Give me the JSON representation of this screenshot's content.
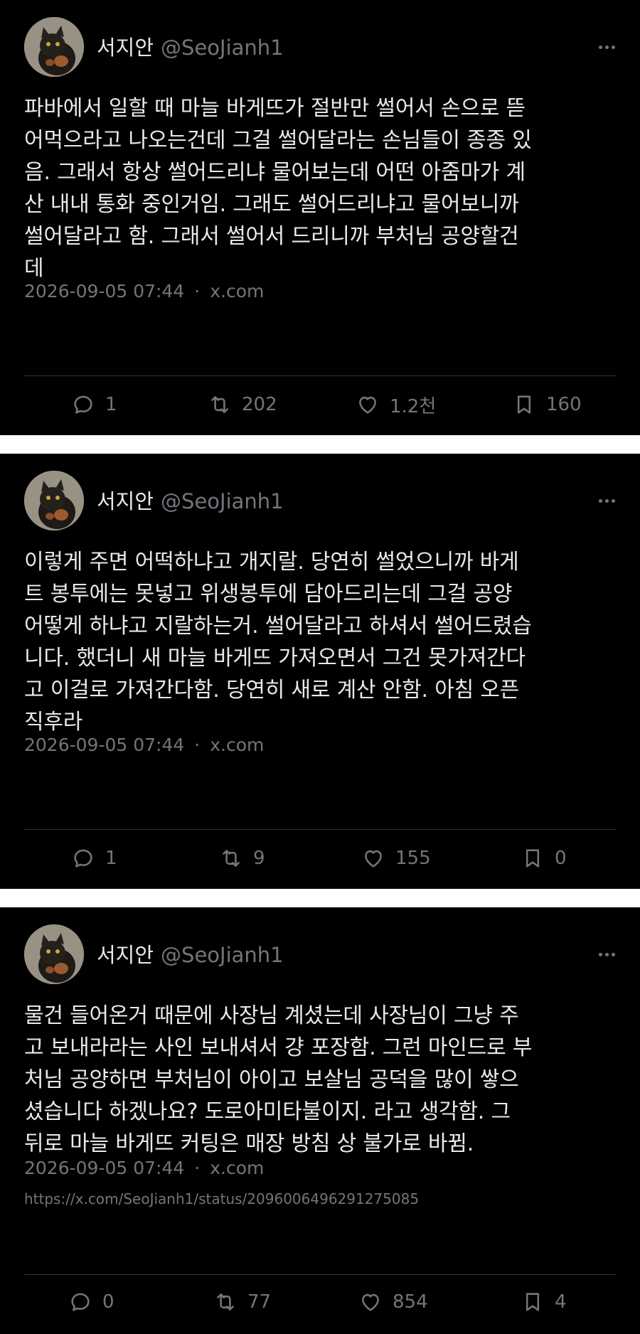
{
  "tweets": [
    {
      "display_name": "서지안",
      "handle": "@SeoJianh1",
      "text": "파바에서 일할 때 마늘 바게뜨가 절반만 썰어서 손으로 뜯\n어먹으라고 나오는건데 그걸 썰어달라는 손님들이 종종 있\n음. 그래서 항상 썰어드리냐 물어보는데 어떤 아줌마가 계\n산 내내 통화 중인거임. 그래도 썰어드리냐고 물어보니까\n썰어달라고 함. 그래서 썰어서 드리니까 부처님 공양할건\n데",
      "timestamp": "2026-09-05 07:44",
      "source": "x.com",
      "replies": "1",
      "retweets": "202",
      "likes": "1.2천",
      "bookmarks": "160"
    },
    {
      "display_name": "서지안",
      "handle": "@SeoJianh1",
      "text": "이렇게 주면 어떡하냐고 개지랄. 당연히 썰었으니까 바게\n트 봉투에는 못넣고 위생봉투에 담아드리는데 그걸 공양\n어떻게 하냐고 지랄하는거. 썰어달라고 하셔서 썰어드렸습\n니다. 했더니 새 마늘 바게뜨 가져오면서 그건 못가져간다\n고 이걸로 가져간다함. 당연히 새로 계산 안함. 아침 오픈\n직후라",
      "timestamp": "2026-09-05 07:44",
      "source": "x.com",
      "replies": "1",
      "retweets": "9",
      "likes": "155",
      "bookmarks": "0"
    },
    {
      "display_name": "서지안",
      "handle": "@SeoJianh1",
      "text": "물건 들어온거 때문에 사장님 계셨는데 사장님이 그냥 주\n고 보내라라는 사인 보내셔서 걍 포장함. 그런 마인드로 부\n처님 공양하면 부처님이 아이고 보살님 공덕을 많이 쌓으\n셨습니다 하겠나요? 도로아미타불이지. 라고 생각함. 그\n뒤로 마늘 바게뜨 커팅은 매장 방침 상 불가로 바뀜.",
      "timestamp": "2026-09-05 07:44",
      "source": "x.com",
      "url": "https://x.com/SeoJianh1/status/2096006496291275085",
      "replies": "0",
      "retweets": "77",
      "likes": "854",
      "bookmarks": "4"
    }
  ],
  "icons": {
    "reply": "reply-icon",
    "retweet": "retweet-icon",
    "like": "heart-icon",
    "bookmark": "bookmark-icon",
    "more": "more-icon"
  },
  "colors": {
    "background": "#000000",
    "text": "#e7e9ea",
    "muted": "#71767b",
    "divider": "#2f3336"
  }
}
